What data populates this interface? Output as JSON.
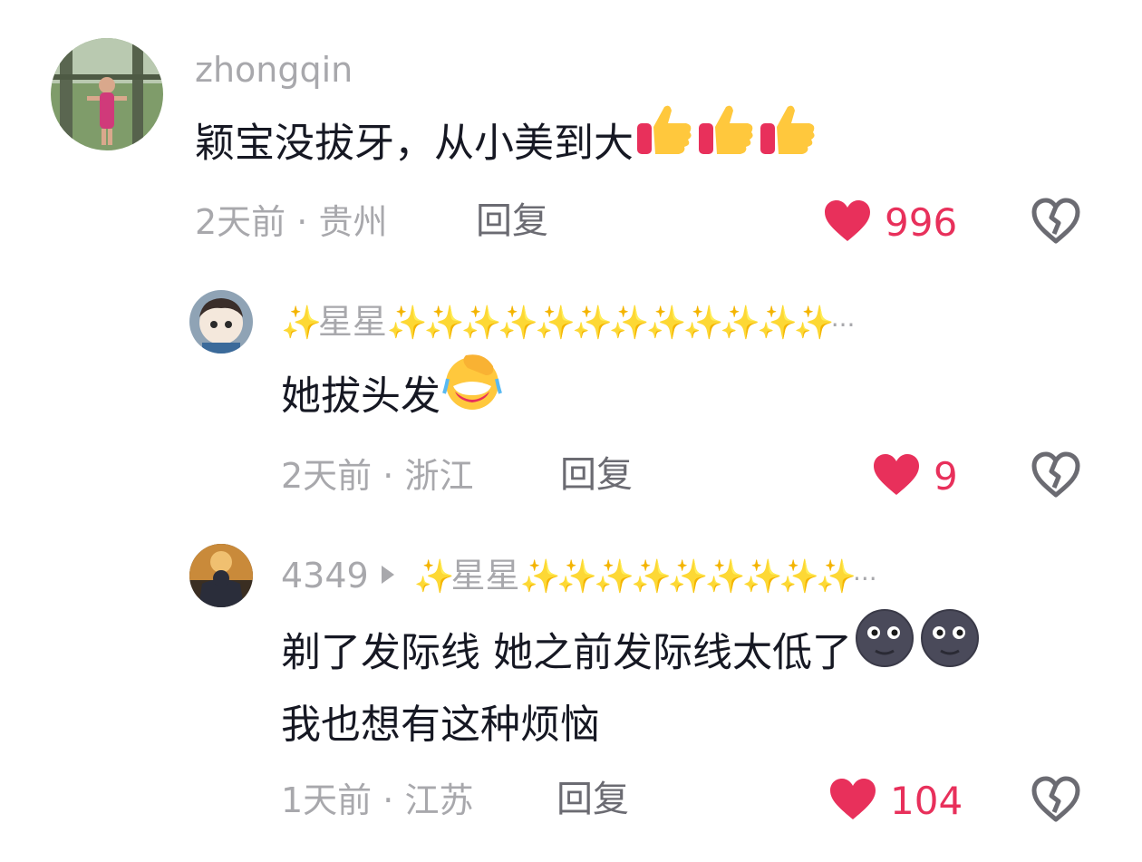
{
  "colors": {
    "like_red": "#e8305b",
    "meta_gray": "#a8a8ac",
    "reply_gray": "#6b6b72",
    "text": "#161823",
    "sparkle": "#f7d86b"
  },
  "comments": [
    {
      "username": "zhongqin",
      "text": "颖宝没拔牙，从小美到大",
      "emojis": [
        "thumbs-up-icon",
        "thumbs-up-icon",
        "thumbs-up-icon"
      ],
      "time": "2天前",
      "sep": "·",
      "location": "贵州",
      "reply_label": "回复",
      "like_count": "996"
    },
    {
      "username": "星星",
      "username_decor": "✨",
      "ellipsis": "···",
      "text": "她拔头发",
      "emojis": [
        "face-palm-crying-icon"
      ],
      "time": "2天前",
      "sep": "·",
      "location": "浙江",
      "reply_label": "回复",
      "like_count": "9"
    },
    {
      "username": "4349",
      "reply_to": "星星",
      "username_decor": "✨",
      "ellipsis": "···",
      "text_line1": "剃了发际线 她之前发际线太低了",
      "text_line2": "我也想有这种烦恼",
      "emojis": [
        "new-moon-face-icon",
        "new-moon-face-icon"
      ],
      "time": "1天前",
      "sep": "·",
      "location": "江苏",
      "reply_label": "回复",
      "like_count": "104"
    }
  ]
}
